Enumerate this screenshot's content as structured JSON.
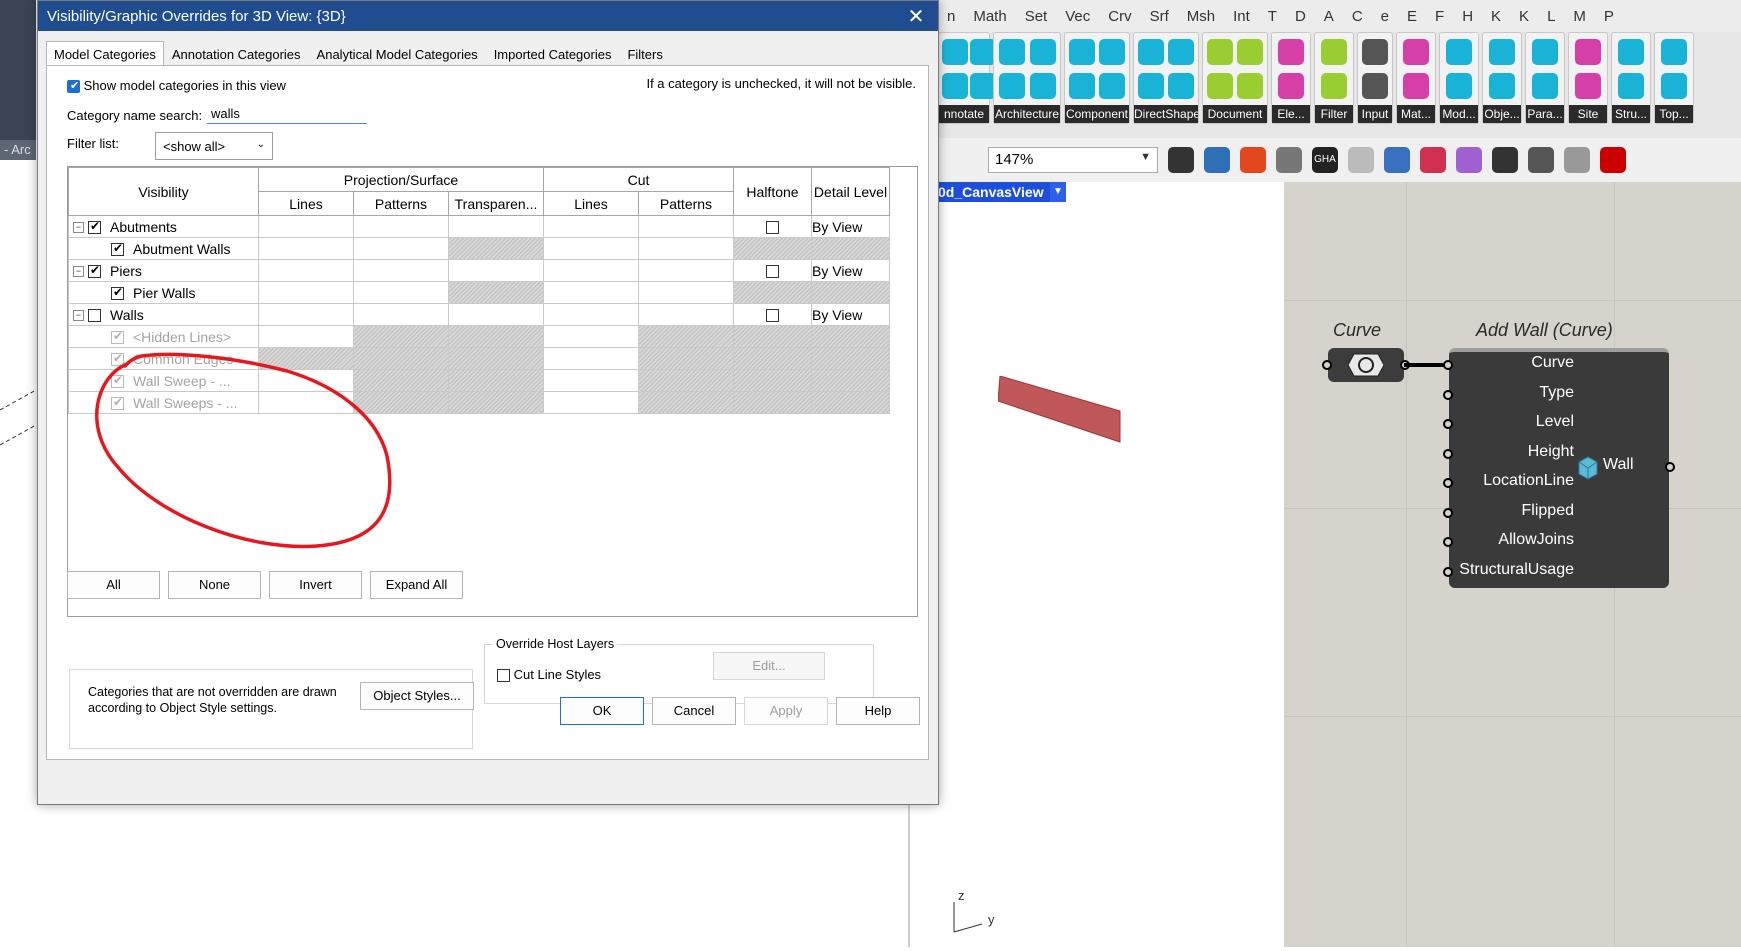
{
  "revit": {
    "side_tab": "- Arc"
  },
  "dialog": {
    "title": "Visibility/Graphic Overrides for 3D View: {3D}",
    "close_glyph": "✕",
    "tabs": [
      "Model Categories",
      "Annotation Categories",
      "Analytical Model Categories",
      "Imported Categories",
      "Filters"
    ],
    "show_categories_label": "Show model categories in this view",
    "hint": "If a category is unchecked, it will not be visible.",
    "search_label": "Category name search:",
    "search_value": "walls",
    "filter_label": "Filter list:",
    "filter_value": "<show all>",
    "headers": {
      "visibility": "Visibility",
      "projection": "Projection/Surface",
      "cut": "Cut",
      "halftone": "Halftone",
      "detail_level": "Detail Level",
      "lines": "Lines",
      "patterns": "Patterns",
      "transparency": "Transparen...",
      "cut_lines": "Lines",
      "cut_patterns": "Patterns"
    },
    "rows": [
      {
        "label": "Abutments",
        "level": 0,
        "checked": true,
        "detail": "By View"
      },
      {
        "label": "Abutment Walls",
        "level": 1,
        "checked": true,
        "detail": ""
      },
      {
        "label": "Piers",
        "level": 0,
        "checked": true,
        "detail": "By View"
      },
      {
        "label": "Pier Walls",
        "level": 1,
        "checked": true,
        "detail": ""
      },
      {
        "label": "Walls",
        "level": 0,
        "checked": false,
        "detail": "By View"
      },
      {
        "label": "<Hidden Lines>",
        "level": 1,
        "checked": true,
        "detail": ""
      },
      {
        "label": "Common Edges",
        "level": 1,
        "checked": true,
        "detail": ""
      },
      {
        "label": "Wall Sweep - ...",
        "level": 1,
        "checked": true,
        "detail": ""
      },
      {
        "label": "Wall Sweeps - ...",
        "level": 1,
        "checked": true,
        "detail": ""
      }
    ],
    "buttons": {
      "all": "All",
      "none": "None",
      "invert": "Invert",
      "expand_all": "Expand All",
      "object_styles": "Object Styles...",
      "edit": "Edit...",
      "ok": "OK",
      "cancel": "Cancel",
      "apply": "Apply",
      "help": "Help"
    },
    "categories_note": "Categories that are not overridden are drawn according to Object Style settings.",
    "override_host_layers": "Override Host Layers",
    "cut_line_styles": "Cut Line Styles"
  },
  "grasshopper": {
    "menu": [
      "n",
      "Math",
      "Set",
      "Vec",
      "Crv",
      "Srf",
      "Msh",
      "Int",
      "T",
      "D",
      "A",
      "C",
      "e",
      "E",
      "F",
      "H",
      "K",
      "K",
      "L",
      "M",
      "P"
    ],
    "ribbon_groups": [
      {
        "label": "nnotate",
        "icon_color": "#1ab3d8"
      },
      {
        "label": "Architecture",
        "icon_color": "#1ab3d8"
      },
      {
        "label": "Component",
        "icon_color": "#1ab3d8"
      },
      {
        "label": "DirectShape",
        "icon_color": "#1ab3d8"
      },
      {
        "label": "Document",
        "icon_color": "#9acd32"
      },
      {
        "label": "Ele...",
        "icon_color": "#d63fa8"
      },
      {
        "label": "Filter",
        "icon_color": "#9acd32"
      },
      {
        "label": "Input",
        "icon_color": "#555555"
      },
      {
        "label": "Mat...",
        "icon_color": "#d63fa8"
      },
      {
        "label": "Mod...",
        "icon_color": "#1ab3d8"
      },
      {
        "label": "Obje...",
        "icon_color": "#1ab3d8"
      },
      {
        "label": "Para...",
        "icon_color": "#1ab3d8"
      },
      {
        "label": "Site",
        "icon_color": "#d63fa8"
      },
      {
        "label": "Stru...",
        "icon_color": "#1ab3d8"
      },
      {
        "label": "Top...",
        "icon_color": "#1ab3d8"
      }
    ],
    "zoom": "147%",
    "canvas_view_tab": "0d_CanvasView",
    "curve_title": "Curve",
    "addwall_title": "Add Wall (Curve)",
    "addwall_inputs": [
      "Curve",
      "Type",
      "Level",
      "Height",
      "LocationLine",
      "Flipped",
      "AllowJoins",
      "StructuralUsage"
    ],
    "addwall_output": "Wall",
    "axis_z": "z",
    "axis_y": "y",
    "colors": {
      "wall_fill": "#c0585a",
      "annotation_red": "#e3191f",
      "accent_blue": "#1e4fdc"
    }
  }
}
